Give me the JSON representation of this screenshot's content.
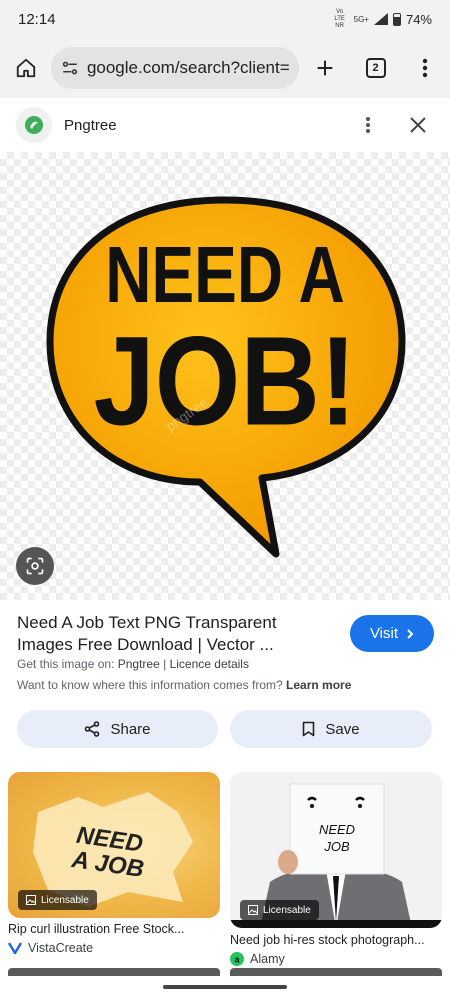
{
  "status_bar": {
    "time": "12:14",
    "network_small": "Vo LTE NR",
    "network_5g": "5G+",
    "battery": "74%"
  },
  "browser": {
    "url": "google.com/search?client=",
    "tab_count": "2"
  },
  "panel": {
    "site_name": "Pngtree"
  },
  "hero_image": {
    "line1": "NEED A",
    "line2": "JOB!",
    "watermark": "pngtree"
  },
  "result": {
    "title": "Need A Job Text PNG Transparent Images Free Download | Vector ...",
    "visit_label": "Visit",
    "source_prefix": "Get this image on:",
    "source_name": "Pngtree",
    "separator": "|",
    "licence_details": "Licence details",
    "info_question": "Want to know where this information comes from?",
    "learn_more": "Learn more"
  },
  "actions": {
    "share_label": "Share",
    "save_label": "Save"
  },
  "related": [
    {
      "image_text_1": "NEED",
      "image_text_2": "A JOB",
      "badge": "Licensable",
      "title": "Rip curl illustration Free Stock...",
      "source": "VistaCreate"
    },
    {
      "image_text_1": "NEED",
      "image_text_2": "JOB",
      "badge": "Licensable",
      "title": "Need job hi-res stock photograph...",
      "source": "Alamy"
    }
  ],
  "colors": {
    "accent": "#1a73e8",
    "bubble": "#f7a800",
    "pill_bg": "#e8eef9"
  }
}
